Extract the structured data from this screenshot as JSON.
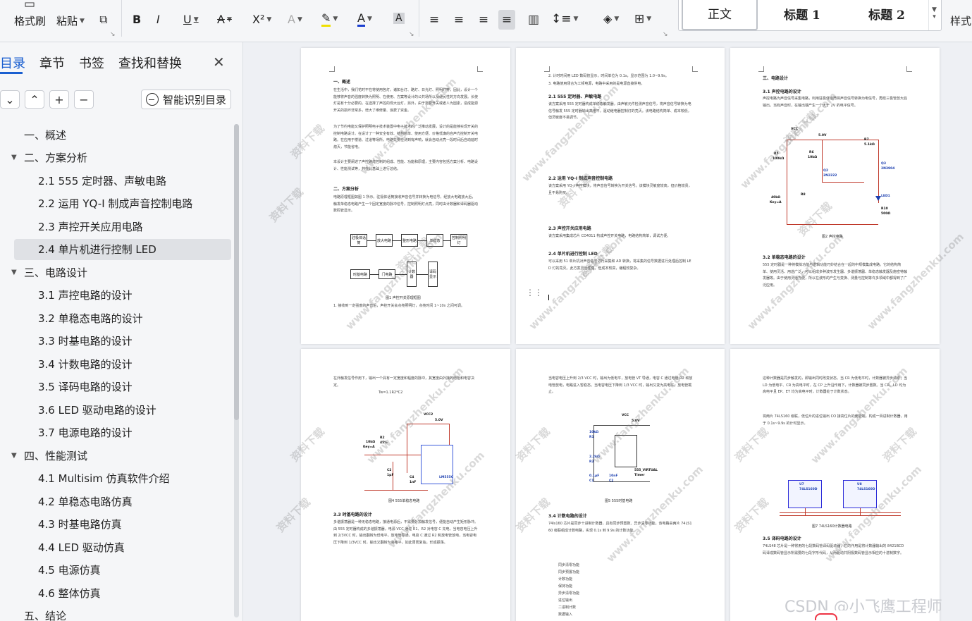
{
  "ribbon": {
    "format_painter": "格式刷",
    "paste": "粘贴",
    "styles_label": "样式",
    "style_zhengwen": "正文",
    "style_heading1": "标题 1",
    "style_heading2": "标题 2",
    "bold": "B",
    "italic": "I",
    "underline": "U",
    "strike": "A",
    "superscript": "X²",
    "font_color": "A",
    "char_shade": "A"
  },
  "nav": {
    "tabs": [
      "目录",
      "章节",
      "书签",
      "查找和替换"
    ],
    "smart_toc": "智能识别目录",
    "toc": [
      {
        "label": "一、概述",
        "level": 1,
        "arrow": ""
      },
      {
        "label": "二、方案分析",
        "level": 1,
        "arrow": "▼"
      },
      {
        "label": "2.1 555 定时器、声敏电路",
        "level": 2,
        "arrow": ""
      },
      {
        "label": "2.2 运用 YQ-I 制成声音控制电路",
        "level": 2,
        "arrow": ""
      },
      {
        "label": "2.3 声控开关应用电路",
        "level": 2,
        "arrow": ""
      },
      {
        "label": "2.4 单片机进行控制 LED",
        "level": 2,
        "arrow": ""
      },
      {
        "label": "三、电路设计",
        "level": 1,
        "arrow": "▼"
      },
      {
        "label": "3.1 声控电路的设计",
        "level": 2,
        "arrow": ""
      },
      {
        "label": "3.2 单稳态电路的设计",
        "level": 2,
        "arrow": ""
      },
      {
        "label": "3.3 时基电路的设计",
        "level": 2,
        "arrow": ""
      },
      {
        "label": "3.4 计数电路的设计",
        "level": 2,
        "arrow": ""
      },
      {
        "label": "3.5 译码电路的设计",
        "level": 2,
        "arrow": ""
      },
      {
        "label": "3.6 LED 驱动电路的设计",
        "level": 2,
        "arrow": ""
      },
      {
        "label": "3.7 电源电路的设计",
        "level": 2,
        "arrow": ""
      },
      {
        "label": "四、性能测试",
        "level": 1,
        "arrow": "▼"
      },
      {
        "label": "4.1 Multisim 仿真软件介绍",
        "level": 2,
        "arrow": ""
      },
      {
        "label": "4.2 单稳态电路仿真",
        "level": 2,
        "arrow": ""
      },
      {
        "label": "4.3 时基电路仿真",
        "level": 2,
        "arrow": ""
      },
      {
        "label": "4.4 LED 驱动仿真",
        "level": 2,
        "arrow": ""
      },
      {
        "label": "4.5 电源仿真",
        "level": 2,
        "arrow": ""
      },
      {
        "label": "4.6 整体仿真",
        "level": 2,
        "arrow": ""
      },
      {
        "label": "五、结论",
        "level": 1,
        "arrow": ""
      }
    ]
  },
  "pages": {
    "p1": {
      "h1": "一、概述",
      "body1": "在生活中，我们花时不在将使用各灯。诸如台灯、路灯、日光灯、照明灯等，因此，设计一个能够将声音的强度转换为照明、在使用、方案等设计的公共场所以及便民性的方向发展。长使灯是有十分必要的。在选择了声控的现大台灯，另外，由于需要开关或者人为因素，造成能源开关的损坏非常多，增大了维修量、浪费了资金。",
      "body2": "为了节约电能又保护照明电子技术装置中电子技术的广泛推动发展，设计的是能够实现开关的控制电路设计。在设计了一种安全有效、结构简单、使用方便、价格低廉的自声光控制开关电路。在应用于楼道、过道等场所，电路只要检测到有声响，就会自动点亮一段时间后自动延时熄灭，节能省电。",
      "body3": "本设计主要阐述了声控路灯控制的组成、性能、功能和原理，主要内容包括方案分析、电路设计、性能测试等，并在此基础上进行总结。",
      "h2": "二、方案分析",
      "body4": "电路原理框图如图 1 所示。驻极体话筒接收声音信号并转换为电信号，经放大电路放大后，触发单稳态电路产生一个固定宽度的脉冲信号，控制照明灯点亮，同时由计数器和译码器驱动数码管显示。",
      "blocks": [
        "驻极体话筒",
        "放大电路",
        "整形电路",
        "单稳态",
        "控制照明灯",
        "计数器",
        "译码显示",
        "时基电路",
        "门电路"
      ],
      "cap1": "图1 声控开关原理框图",
      "body5": "1. 接收到一定强度的声音后，声控开关会点亮照明灯，点亮时间 1~10s 之间可调。"
    },
    "p2": {
      "body1": "2. 计时时间用 LED 数码管显示，时间单位为 0.1s，显示范围为 1.0~9.9s。",
      "body2": "3. 电路使用场合为工频电源，电路中采用的是电源直接供电。",
      "h1": "2.1 555 定时器、声敏电路",
      "body3": "该方案采用 555 定时器构成单稳态触发器，由声敏元件检测声音信号，将声音信号转换为电信号触发 555 定时器输出高电平，驱动继电器控制灯的亮灭。该电路结构简单、成本较低，但灵敏度不易调节。",
      "h2": "2.2 运用 YQ-I 制成声音控制电路",
      "body4": "该方案采用 YQ-I 声控模块，将声音信号转换为开关信号。该模块灵敏度较高，但价格较贵，且不易购买。",
      "h3": "2.3 声控开关应用电路",
      "body5": "该方案采用集成芯片 CD4011 构成声控开关电路，电路结构简单，调试方便。",
      "h4": "2.4 单片机进行控制 LED",
      "body6": "可以采用 51 单片机对声音信号进行采集和 AD 转换，将采集的信号数据进行处理后控制 LED 灯的亮灭。此方案灵活性强，但成本较高，编程较复杂。"
    },
    "p3": {
      "h1": "三、电路设计",
      "h2": "3.1 声控电路的设计",
      "body1": "声控电路为声音信号采集电路，利用驻极体话筒将声音信号转换为电信号，再经三极管放大后输出。当有声音时，在输出端产生一个大于 2V 的电平信号。",
      "vcc": "VCC",
      "vcc_v": "5.0V",
      "labels": [
        "R5",
        "100kΩ",
        "R6",
        "10kΩ",
        "R7",
        "5.1kΩ",
        "Q2",
        "2N2222",
        "Q3",
        "2N3904",
        "LED1",
        "R8",
        "40kΩ",
        "Key=A",
        "R10",
        "500Ω"
      ],
      "cap": "图2 声控电路",
      "h3": "3.2 单稳态电路的设计",
      "body2": "555 定时器是一种将模拟功能与逻辑功能巧妙结合在一起的中规模集成电路。它的结构简单、使用灵活、用途广泛，可以组成多种波形发生器、多谐振荡器、单稳态触发器及施密特触发器等。由于使用灵活方便，所以在波形的产生与变换、测量与控制等许多领域中都得到了广泛应用。"
    },
    "p4": {
      "body1": "在外触发信号作用下，输出一个具有一定宽度和幅度的脉冲，其宽度由外接的电阻和电容决定。",
      "formula": "Tw=1.1R2*C2",
      "vcc": "VCC2",
      "vcc_v": "5.0V",
      "labels": [
        "10kΩ",
        "Key=A",
        "R2",
        "45%",
        "C2",
        "1μF",
        "C4",
        "1nF",
        "LM555C"
      ],
      "cap": "图4 555单稳态电路",
      "h1": "3.3 时基电路的设计",
      "body2": "多谐振荡器是一种无稳态电路，接通电源后，不需要外加触发信号，便能自动产生矩形脉冲。由 555 定时器构成的多谐振荡器，电源 VCC 通过 R1、R2 对电容 C 充电，当电容电压上升到 2/3VCC 时，输出翻转为低电平，放电管导通，电容 C 通过 R2 和放电管放电，当电容电压下降到 1/3VCC 时，输出又翻转为高电平，如此周而复始，形成振荡。"
    },
    "p5": {
      "body1": "当电容电压上升到 2/3 VCC 时，输出为低电平，放电管 VT 导通，电容 C 通过电阻 R2 和放电管放电，电路进入暂稳态。当电容电压下降到 1/3 VCC 时，输出又变为高电平，放电管截止。",
      "vcc": "VCC",
      "vcc_v": "5.0V",
      "labels": [
        "10kΩ",
        "R1",
        "2.2kΩ",
        "R2",
        "0.1μF",
        "C1",
        "10nF",
        "C2",
        "555_VIRTUAL",
        "Timer"
      ],
      "cap": "图5 555时基电路",
      "h1": "3.4 计数电路的设计",
      "body2": "74ls160 芯片是同步十进制计数器，具有同步预置数、异步清零功能。该电路由两片 74LS160 级联组成计数电路，实现 0.1s 到 9.9s 的计数功能。",
      "list": [
        "同步清零功能",
        "同步预置功能",
        "计数功能",
        "保持功能",
        "异步清零功能",
        "进位输出",
        "二进制计数",
        "数据输入",
        "复位端"
      ]
    },
    "p6": {
      "body1": "这种计数器是同步触发的，即输出同时改变状态。当 CR 为低电平时，计数器被异步清零；当 LD 为低电平、CR 为高电平时，在 CP 上升沿作用下，计数器被同步置数。当 CR、LD 均为高电平且 EP、ET 均为高电平时，计数器处于计数状态。",
      "body2": "将两片 74LS160 级联，低位片的进位输出 CO 接高位片的使能端，构成一百进制计数器，用于 0.1s~9.9s 的计时显示。",
      "chips": [
        "U7",
        "74LS160D",
        "U8",
        "74LS160D"
      ],
      "cap": "图7 74LS160计数器电路",
      "h1": "3.5 译码电路的设计",
      "body3": "74LS48 芯片是一种常用的七段数码管译码驱动器，它的作用是将计数器输出的 8421BCD 码译成数码管显示所需要的七段字形代码，从而驱动共阴极数码管显示相应的十进制数字。"
    },
    "watermarks": [
      "资料下载",
      "www.fangzhenku.com"
    ]
  },
  "csdn": "CSDN @小飞鹰工程师"
}
